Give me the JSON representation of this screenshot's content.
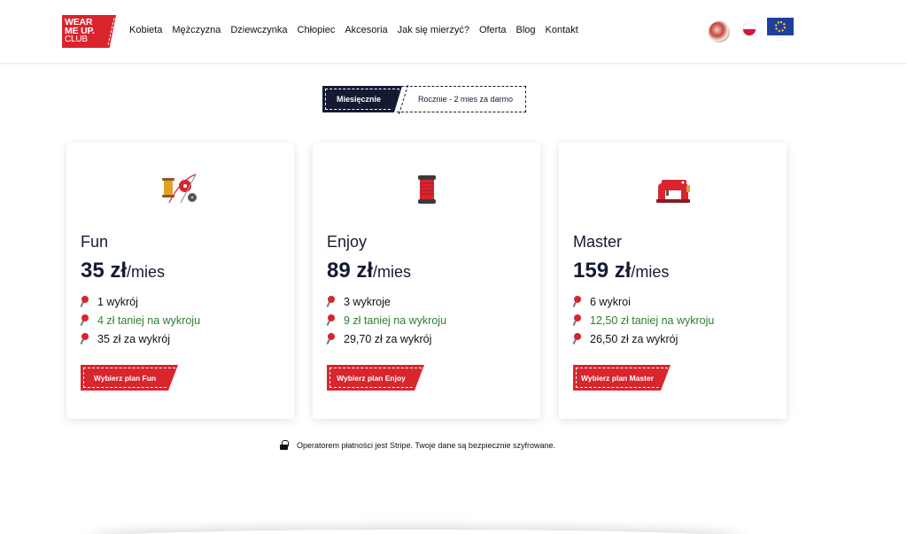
{
  "brand": {
    "logo_line1": "WEAR",
    "logo_line2": "ME UP.",
    "logo_line3": "CLUB",
    "accent": "#d9252e",
    "navy": "#151a33",
    "green": "#2e7d32"
  },
  "nav": [
    "Kobieta",
    "Mężczyzna",
    "Dziewczynka",
    "Chłopiec",
    "Akcesoria",
    "Jak się mierzyć?",
    "Oferta",
    "Blog",
    "Kontakt"
  ],
  "header_icons": {
    "avatar": "avatar-icon",
    "language": "poland-flag-icon",
    "eu": "eu-flag-icon"
  },
  "toggle": {
    "monthly": "Miesięcznie",
    "yearly": "Rocznie - 2 mies za darmo",
    "selected": "monthly"
  },
  "plans": [
    {
      "name": "Fun",
      "price": "35 zł",
      "period": "/mies",
      "icon": "sewing-kit-icon",
      "features": [
        "1 wykrój",
        "4 zł taniej na wykroju",
        "35 zł za wykrój"
      ],
      "button": "Wybierz plan Fun"
    },
    {
      "name": "Enjoy",
      "price": "89 zł",
      "period": "/mies",
      "icon": "thread-spool-icon",
      "features": [
        "3 wykroje",
        "9 zł taniej na wykroju",
        "29,70 zł za wykrój"
      ],
      "button": "Wybierz plan Enjoy"
    },
    {
      "name": "Master",
      "price": "159 zł",
      "period": "/mies",
      "icon": "sewing-machine-icon",
      "features": [
        "6 wykroi",
        "12,50 zł taniej na wykroju",
        "26,50 zł za wykrój"
      ],
      "button": "Wybierz plan Master"
    }
  ],
  "payment_note": "Operatorem płatności jest Stripe. Twoje dane są bezpiecznie szyfrowane."
}
